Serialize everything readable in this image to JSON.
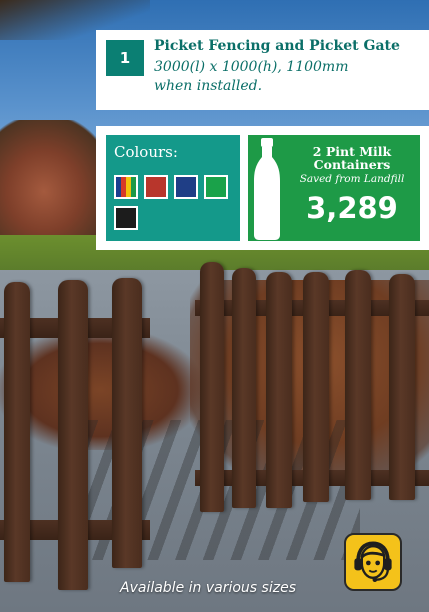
{
  "product": {
    "number": "1",
    "title": "Picket Fencing and Picket Gate",
    "size_line1": "3000(l) x 1000(h), 1100mm",
    "size_line2": "when installed."
  },
  "colours": {
    "label": "Colours:",
    "swatches": [
      {
        "name": "mixed-stripes",
        "colors": [
          "#1a3f8f",
          "#d63a28",
          "#f2c20d",
          "#1d9a48"
        ]
      },
      {
        "name": "red",
        "color": "#b8362c"
      },
      {
        "name": "blue",
        "color": "#1f3e86"
      },
      {
        "name": "green",
        "color": "#1aa24a"
      },
      {
        "name": "black",
        "color": "#1c1c1c"
      }
    ]
  },
  "recycling": {
    "line1": "2 Pint Milk",
    "line2": "Containers",
    "line3": "Saved from Landfill",
    "count": "3,289",
    "icon": "milk-bottle-icon"
  },
  "footer": {
    "availability": "Available in various sizes",
    "support_icon": "headset-support-icon"
  },
  "theme": {
    "teal": "#0b7f73",
    "green": "#1e9a47",
    "yellow": "#f4c21a"
  }
}
